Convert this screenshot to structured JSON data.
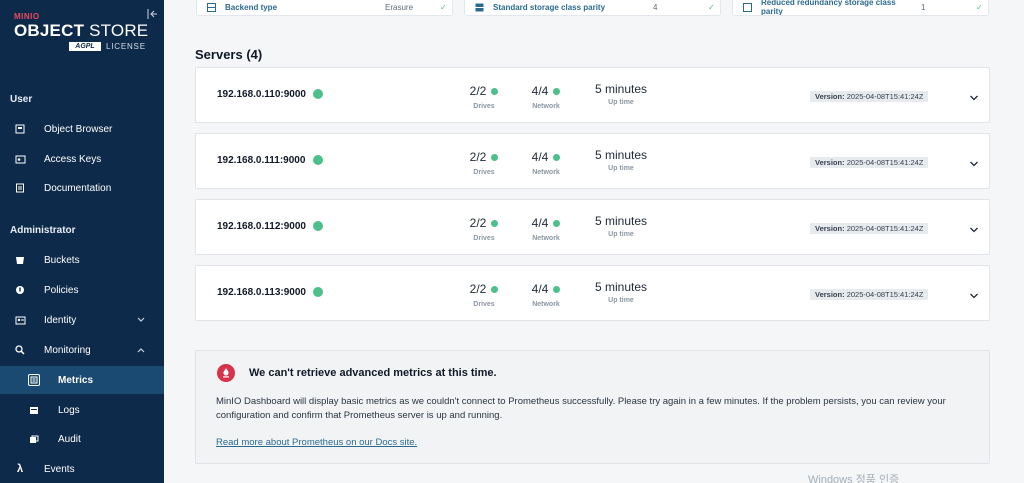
{
  "brand": {
    "mini": "MINIO",
    "name_bold": "OBJECT",
    "name_thin": " STORE",
    "badge": "AGPL",
    "license": "LICENSE"
  },
  "sidebar": {
    "user_section": "User",
    "user_items": [
      {
        "label": "Object Browser",
        "icon": "object-browser-icon"
      },
      {
        "label": "Access Keys",
        "icon": "access-keys-icon"
      },
      {
        "label": "Documentation",
        "icon": "documentation-icon"
      }
    ],
    "admin_section": "Administrator",
    "admin_items": [
      {
        "label": "Buckets",
        "icon": "buckets-icon"
      },
      {
        "label": "Policies",
        "icon": "policies-icon"
      },
      {
        "label": "Identity",
        "icon": "identity-icon"
      },
      {
        "label": "Monitoring",
        "icon": "monitoring-icon"
      },
      {
        "label": "Metrics",
        "icon": "metrics-icon"
      },
      {
        "label": "Logs",
        "icon": "logs-icon"
      },
      {
        "label": "Audit",
        "icon": "audit-icon"
      },
      {
        "label": "Events",
        "icon": "lambda-icon"
      }
    ]
  },
  "stats": [
    {
      "label": "Backend type",
      "value": "Erasure"
    },
    {
      "label": "Standard storage class parity",
      "value": "4"
    },
    {
      "label": "Reduced redundancy storage class parity",
      "value": "1"
    }
  ],
  "servers_title": "Servers (4)",
  "servers": [
    {
      "host": "192.168.0.110:9000",
      "drives": "2/2",
      "network": "4/4",
      "uptime": "5 minutes",
      "version": "2025-04-08T15:41:24Z"
    },
    {
      "host": "192.168.0.111:9000",
      "drives": "2/2",
      "network": "4/4",
      "uptime": "5 minutes",
      "version": "2025-04-08T15:41:24Z"
    },
    {
      "host": "192.168.0.112:9000",
      "drives": "2/2",
      "network": "4/4",
      "uptime": "5 minutes",
      "version": "2025-04-08T15:41:24Z"
    },
    {
      "host": "192.168.0.113:9000",
      "drives": "2/2",
      "network": "4/4",
      "uptime": "5 minutes",
      "version": "2025-04-08T15:41:24Z"
    }
  ],
  "labels": {
    "drives": "Drives",
    "network": "Network",
    "uptime": "Up time",
    "version": "Version:"
  },
  "banner": {
    "title": "We can't retrieve advanced metrics at this time.",
    "body": "MinIO Dashboard will display basic metrics as we couldn't connect to Prometheus successfully. Please try again in a few minutes. If the problem persists, you can review your configuration and confirm that Prometheus server is up and running.",
    "link": "Read more about Prometheus on our Docs site."
  },
  "watermark": "Windows 정품 인증",
  "colors": {
    "sidebar": "#0e2a4a",
    "sidebar_active": "#1a4a72",
    "status_ok": "#4cbf8a",
    "brand_red": "#e94b5b",
    "link": "#2b6b8f"
  }
}
